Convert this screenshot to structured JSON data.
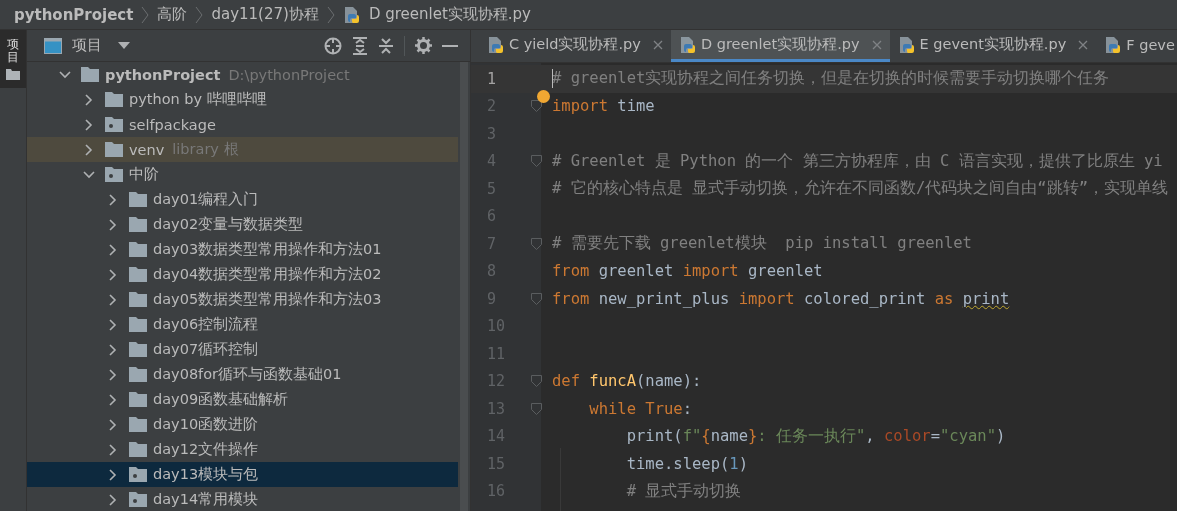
{
  "breadcrumbs": [
    {
      "label": "pythonProject",
      "kind": "project"
    },
    {
      "label": "高阶",
      "kind": "folder"
    },
    {
      "label": "day11(27)协程",
      "kind": "folder"
    },
    {
      "label": "D greenlet实现协程.py",
      "kind": "file"
    }
  ],
  "side_strip": {
    "label": "项目"
  },
  "project_panel": {
    "title": "项目",
    "tree": [
      {
        "name": "pythonProject",
        "hint": "D:\\pythonProject",
        "kind": "root",
        "expanded": true,
        "selected": false,
        "children": [
          {
            "name": "python by 哔哩哔哩",
            "kind": "folder",
            "expanded": false,
            "selected": false
          },
          {
            "name": "selfpackage",
            "kind": "package",
            "expanded": false,
            "selected": false
          },
          {
            "name": "venv",
            "hint": "library 根",
            "kind": "excluded",
            "expanded": false,
            "selected": false
          },
          {
            "name": "中阶",
            "kind": "package",
            "expanded": true,
            "selected": false,
            "children": [
              {
                "name": "day01编程入门",
                "kind": "folder",
                "expanded": false,
                "selected": false
              },
              {
                "name": "day02变量与数据类型",
                "kind": "folder",
                "expanded": false,
                "selected": false
              },
              {
                "name": "day03数据类型常用操作和方法01",
                "kind": "folder",
                "expanded": false,
                "selected": false
              },
              {
                "name": "day04数据类型常用操作和方法02",
                "kind": "folder",
                "expanded": false,
                "selected": false
              },
              {
                "name": "day05数据类型常用操作和方法03",
                "kind": "folder",
                "expanded": false,
                "selected": false
              },
              {
                "name": "day06控制流程",
                "kind": "folder",
                "expanded": false,
                "selected": false
              },
              {
                "name": "day07循环控制",
                "kind": "folder",
                "expanded": false,
                "selected": false
              },
              {
                "name": "day08for循环与函数基础01",
                "kind": "folder",
                "expanded": false,
                "selected": false
              },
              {
                "name": "day09函数基础解析",
                "kind": "folder",
                "expanded": false,
                "selected": false
              },
              {
                "name": "day10函数进阶",
                "kind": "folder",
                "expanded": false,
                "selected": false
              },
              {
                "name": "day12文件操作",
                "kind": "folder",
                "expanded": false,
                "selected": false
              },
              {
                "name": "day13模块与包",
                "kind": "package",
                "expanded": false,
                "selected": true
              },
              {
                "name": "day14常用模块",
                "kind": "package",
                "expanded": false,
                "selected": false
              }
            ]
          }
        ]
      }
    ]
  },
  "editor_tabs": [
    {
      "label": "C yield实现协程.py",
      "selected": false,
      "closable": true
    },
    {
      "label": "D greenlet实现协程.py",
      "selected": true,
      "closable": true
    },
    {
      "label": "E gevent实现协程.py",
      "selected": false,
      "closable": true
    },
    {
      "label": "F geve",
      "selected": false,
      "closable": false
    }
  ],
  "code_lines": [
    {
      "number": "1",
      "current": true,
      "fold": false,
      "tokens": [
        {
          "kind": "comment",
          "text": "# greenlet实现协程之间任务切换，但是在切换的时候需要手动切换哪个任务"
        }
      ]
    },
    {
      "number": "2",
      "current": false,
      "fold": true,
      "tokens": [
        {
          "kind": "keyword",
          "text": "import"
        },
        {
          "kind": "plain",
          "text": " time"
        }
      ]
    },
    {
      "number": "3",
      "current": false,
      "fold": false
    },
    {
      "number": "4",
      "current": false,
      "fold": true,
      "tokens": [
        {
          "kind": "comment",
          "text": "# Greenlet 是 Python 的一个 第三方协程库，由 C 语言实现，提供了比原生 yi"
        }
      ]
    },
    {
      "number": "5",
      "current": false,
      "fold": false,
      "tokens": [
        {
          "kind": "comment",
          "text": "# 它的核心特点是 显式手动切换，允许在不同函数/代码块之间自由“跳转”，实现单线"
        }
      ]
    },
    {
      "number": "6",
      "current": false,
      "fold": false
    },
    {
      "number": "7",
      "current": false,
      "fold": true,
      "tokens": [
        {
          "kind": "comment",
          "text": "# 需要先下载 greenlet模块  pip install greenlet"
        }
      ]
    },
    {
      "number": "8",
      "current": false,
      "fold": false,
      "tokens": [
        {
          "kind": "keyword",
          "text": "from"
        },
        {
          "kind": "plain",
          "text": " greenlet "
        },
        {
          "kind": "keyword",
          "text": "import"
        },
        {
          "kind": "plain",
          "text": " greenlet"
        }
      ]
    },
    {
      "number": "9",
      "current": false,
      "fold": true,
      "tokens": [
        {
          "kind": "keyword",
          "text": "from"
        },
        {
          "kind": "plain",
          "text": " new_print_plus "
        },
        {
          "kind": "keyword",
          "text": "import"
        },
        {
          "kind": "plain",
          "text": " colored_print "
        },
        {
          "kind": "keyword",
          "text": "as "
        },
        {
          "kind": "warning",
          "text": "print"
        }
      ]
    },
    {
      "number": "10",
      "current": false,
      "fold": false
    },
    {
      "number": "11",
      "current": false,
      "fold": false
    },
    {
      "number": "12",
      "current": false,
      "fold": true,
      "tokens": [
        {
          "kind": "keyword",
          "text": "def "
        },
        {
          "kind": "function",
          "text": "funcA"
        },
        {
          "kind": "plain",
          "text": "(name):"
        }
      ]
    },
    {
      "number": "13",
      "current": false,
      "fold": true,
      "tokens": [
        {
          "kind": "keyword",
          "text": "    while True"
        },
        {
          "kind": "plain",
          "text": ":"
        }
      ]
    },
    {
      "number": "14",
      "current": false,
      "fold": false,
      "tokens": [
        {
          "kind": "plain",
          "text": "        print("
        },
        {
          "kind": "string",
          "text": "f\""
        },
        {
          "kind": "keyword",
          "text": "{"
        },
        {
          "kind": "plain",
          "text": "name"
        },
        {
          "kind": "keyword",
          "text": "}"
        },
        {
          "kind": "string",
          "text": ": 任务一执行\""
        },
        {
          "kind": "plain",
          "text": ", "
        },
        {
          "kind": "param",
          "text": "color"
        },
        {
          "kind": "plain",
          "text": "="
        },
        {
          "kind": "string",
          "text": "\"cyan\""
        },
        {
          "kind": "plain",
          "text": ")"
        }
      ]
    },
    {
      "number": "15",
      "current": false,
      "fold": false,
      "tokens": [
        {
          "kind": "plain",
          "text": "        time.sleep("
        },
        {
          "kind": "number",
          "text": "1"
        },
        {
          "kind": "plain",
          "text": ")"
        }
      ]
    },
    {
      "number": "16",
      "current": false,
      "fold": false,
      "tokens": [
        {
          "kind": "comment",
          "text": "        # 显式手动切换"
        }
      ]
    }
  ]
}
